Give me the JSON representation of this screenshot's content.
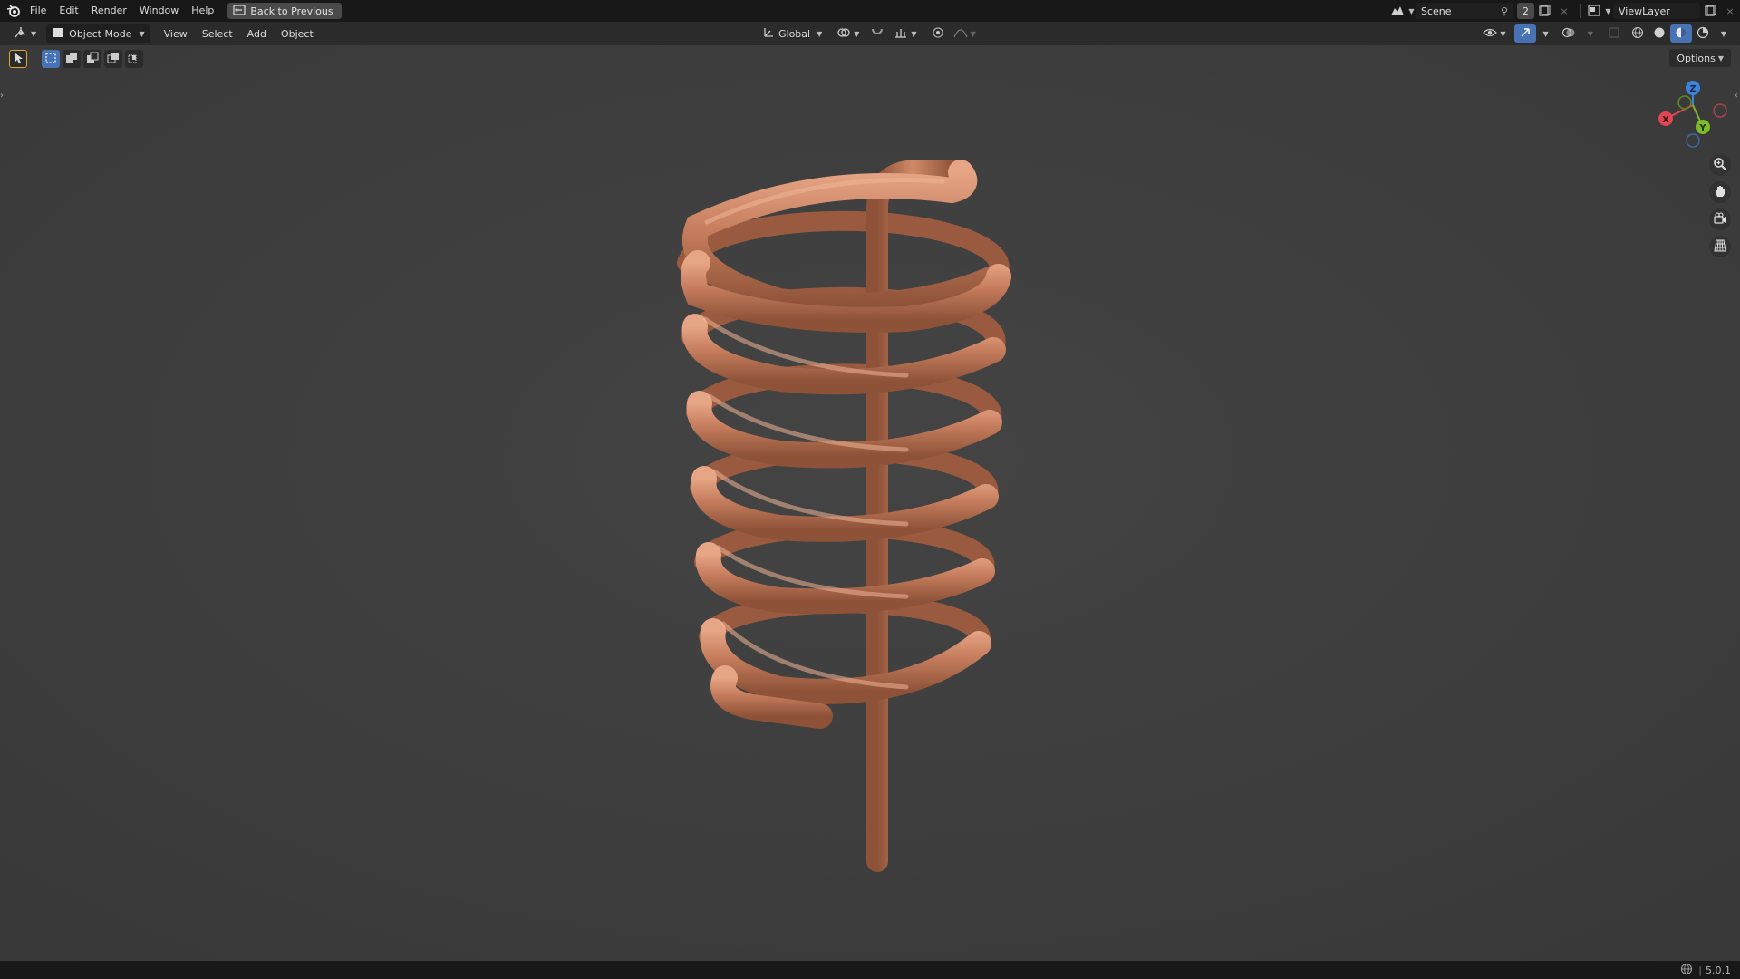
{
  "menu": {
    "items": [
      "File",
      "Edit",
      "Render",
      "Window",
      "Help"
    ],
    "back_button": "Back to Previous"
  },
  "topright": {
    "scene_label": "Scene",
    "scene_users": "2",
    "viewlayer_label": "ViewLayer"
  },
  "header": {
    "mode": "Object Mode",
    "menus": [
      "View",
      "Select",
      "Add",
      "Object"
    ],
    "transform_orientation": "Global",
    "options_label": "Options"
  },
  "gizmo": {
    "x": "X",
    "y": "Y",
    "z": "Z"
  },
  "status": {
    "version": "5.0.1"
  },
  "colors": {
    "accent": "#4772b3",
    "copper": "#c27a5a",
    "axis_x": "#e04552",
    "axis_y": "#7cbb2a",
    "axis_z": "#3d84dd"
  },
  "icons": [
    "blender-logo-icon",
    "editor-type-icon",
    "object-mode-icon",
    "transform-orientation-icon",
    "snap-icon",
    "proportional-icon",
    "zoom-icon",
    "hand-pan-icon",
    "camera-icon",
    "grid-icon",
    "globe-icon"
  ]
}
